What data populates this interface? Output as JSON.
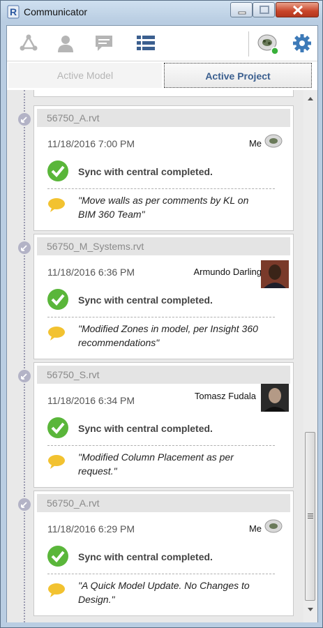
{
  "window": {
    "title": "Communicator"
  },
  "toolbar": {
    "icons": [
      "network-icon",
      "person-icon",
      "chat-icon",
      "list-icon",
      "project-thumbnail",
      "gear-icon"
    ]
  },
  "tabs": [
    {
      "label": "Active Model",
      "active": false
    },
    {
      "label": "Active Project",
      "active": true
    }
  ],
  "feed": [
    {
      "file": "56750_A.rvt",
      "datetime": "11/18/2016 7:00 PM",
      "user": "Me",
      "status": "Sync with central completed.",
      "comment": "\"Move walls as per comments by KL on BIM 360 Team\""
    },
    {
      "file": "56750_M_Systems.rvt",
      "datetime": "11/18/2016 6:36 PM",
      "user": "Armundo Darling",
      "status": "Sync with central completed.",
      "comment": "\"Modified Zones in model, per Insight 360 recommendations\""
    },
    {
      "file": "56750_S.rvt",
      "datetime": "11/18/2016 6:34 PM",
      "user": "Tomasz Fudala",
      "status": "Sync with central completed.",
      "comment": "\"Modified Column Placement as per request.\""
    },
    {
      "file": "56750_A.rvt",
      "datetime": "11/18/2016 6:29 PM",
      "user": "Me",
      "status": "Sync with central completed.",
      "comment": "\"A Quick Model Update. No Changes to Design.\""
    }
  ],
  "colors": {
    "accent": "#3b5f8f",
    "success": "#5ab63a",
    "comment_bubble": "#f2c230"
  }
}
